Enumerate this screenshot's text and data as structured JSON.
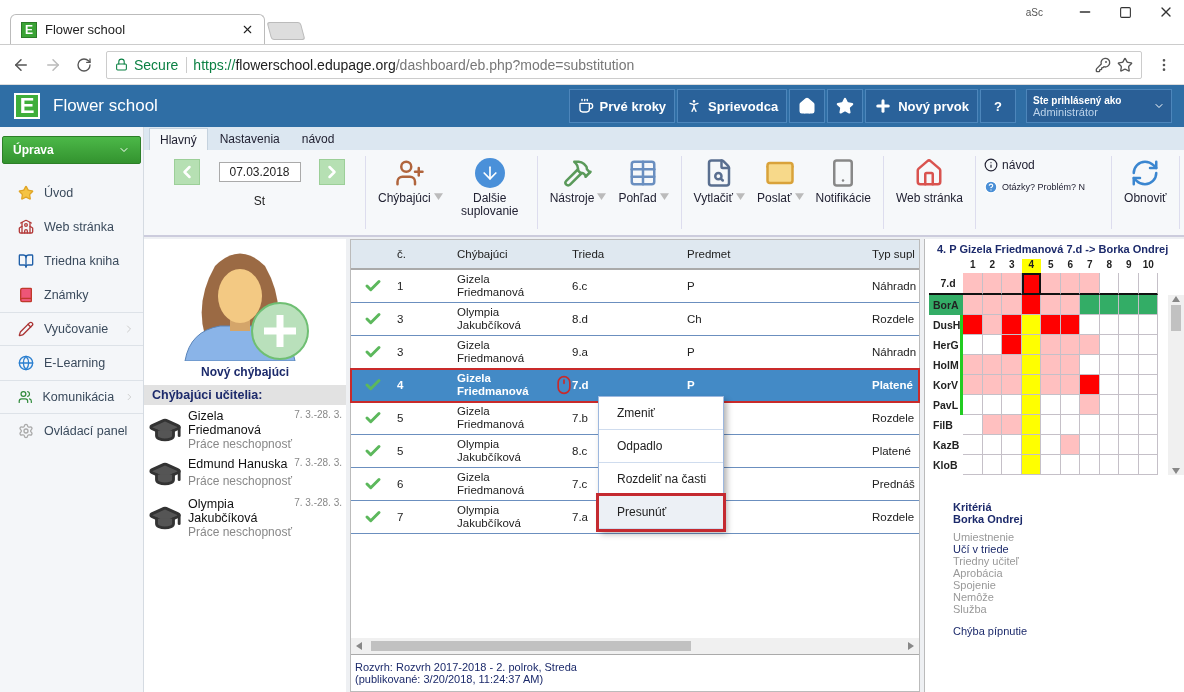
{
  "browser": {
    "tab_title": "Flower school",
    "favicon_letter": "E",
    "profile": "aSc",
    "secure_label": "Secure",
    "url_scheme": "https://",
    "url_host": "flowerschool.edupage.org",
    "url_path": "/dashboard/eb.php?mode=substitution"
  },
  "header": {
    "logo_letter": "E",
    "title": "Flower school",
    "buttons": [
      {
        "kind": "cup",
        "label": "Prvé kroky"
      },
      {
        "kind": "walk",
        "label": "Sprievodca"
      },
      {
        "kind": "home"
      },
      {
        "kind": "star"
      },
      {
        "kind": "plus",
        "label": "Nový prvok"
      },
      {
        "kind": "text",
        "label": "?"
      }
    ],
    "user": {
      "caption": "Ste prihlásený ako",
      "name": "Administrátor"
    }
  },
  "sidebar": {
    "button": "Úprava",
    "items": [
      {
        "kind": "star",
        "label": "Úvod",
        "submenu": false
      },
      {
        "kind": "school",
        "label": "Web stránka",
        "submenu": false
      },
      {
        "kind": "book",
        "label": "Triedna kniha",
        "submenu": false
      },
      {
        "kind": "grades",
        "label": "Známky",
        "submenu": false
      },
      {
        "kind": "teach",
        "label": "Vyučovanie",
        "submenu": true
      },
      {
        "kind": "globe",
        "label": "E-Learning",
        "submenu": false
      },
      {
        "kind": "people",
        "label": "Komunikácia",
        "submenu": true
      },
      {
        "kind": "gear",
        "label": "Ovládací panel",
        "submenu": false
      }
    ]
  },
  "tabs": [
    {
      "label": "Hlavný",
      "selected": true
    },
    {
      "label": "Nastavenia",
      "selected": false
    },
    {
      "label": "návod",
      "selected": false
    }
  ],
  "toolbar": {
    "date": "07.03.2018",
    "weekday": "St",
    "groups": [
      {
        "items": [
          {
            "kind": "person-add",
            "label": "Chýbajúci",
            "dropdown": true
          },
          {
            "kind": "down",
            "label": "Dalšie suplovanie",
            "dropdown": false
          }
        ]
      },
      {
        "items": [
          {
            "kind": "tools",
            "label": "Nástroje",
            "dropdown": true
          },
          {
            "kind": "grid",
            "label": "Pohľad",
            "dropdown": true
          }
        ]
      },
      {
        "items": [
          {
            "kind": "print",
            "label": "Vytlačiť",
            "dropdown": true
          },
          {
            "kind": "mail",
            "label": "Poslať",
            "dropdown": true
          },
          {
            "kind": "phone",
            "label": "Notifikácie",
            "dropdown": false
          }
        ]
      },
      {
        "items": [
          {
            "kind": "house",
            "label": "Web stránka",
            "dropdown": false
          }
        ]
      }
    ],
    "help": {
      "guide": "návod",
      "question": "Otázky? Problém? N"
    },
    "refresh": "Obnoviť"
  },
  "absent": {
    "new_label": "Nový chýbajúci",
    "heading": "Chýbajúci učitelia:",
    "teachers": [
      {
        "name": "Gizela Friedmanová",
        "dates": "7. 3.-28. 3.",
        "reason": "Práce neschopnosť"
      },
      {
        "name": "Edmund Hanuska",
        "dates": "7. 3.-28. 3.",
        "reason": "Práce neschopnosť"
      },
      {
        "name": "Olympia Jakubčíková",
        "dates": "7. 3.-28. 3.",
        "reason": "Práce neschopnosť"
      }
    ]
  },
  "table": {
    "columns": [
      "č.",
      "Chýbajúci",
      "Trieda",
      "Predmet",
      "Typ supl"
    ],
    "rows": [
      {
        "done": true,
        "selected": false,
        "cells": [
          "1",
          "Gizela Friedmanová",
          "6.c",
          "P",
          "Náhradn"
        ]
      },
      {
        "done": true,
        "selected": false,
        "cells": [
          "3",
          "Olympia Jakubčíková",
          "8.d",
          "Ch",
          "Rozdele"
        ]
      },
      {
        "done": true,
        "selected": false,
        "cells": [
          "3",
          "Gizela Friedmanová",
          "9.a",
          "P",
          "Náhradn"
        ]
      },
      {
        "done": true,
        "selected": true,
        "cells": [
          "4",
          "Gizela Friedmanová",
          "7.d",
          "P",
          "Platené"
        ]
      },
      {
        "done": true,
        "selected": false,
        "cells": [
          "5",
          "Gizela Friedmanová",
          "7.b",
          "",
          "Rozdele"
        ]
      },
      {
        "done": true,
        "selected": false,
        "cells": [
          "5",
          "Olympia Jakubčíková",
          "8.c",
          "",
          "Platené"
        ]
      },
      {
        "done": true,
        "selected": false,
        "cells": [
          "6",
          "Gizela Friedmanová",
          "7.c",
          "",
          "Prednáš"
        ]
      },
      {
        "done": true,
        "selected": false,
        "cells": [
          "7",
          "Olympia Jakubčíková",
          "7.a",
          "",
          "Rozdele"
        ]
      }
    ],
    "footer": [
      "Rozvrh: Rozvrh 2017-2018 - 2. polrok, Streda",
      "(publikované: 3/20/2018, 11:24:37 AM)"
    ]
  },
  "context_menu": [
    {
      "label": "Zmeniť",
      "selected": false
    },
    {
      "label": "Odpadlo",
      "selected": false
    },
    {
      "label": "Rozdeliť na časti",
      "selected": false
    },
    {
      "label": "Presunúť",
      "selected": true
    }
  ],
  "grid": {
    "title": "4. P Gizela Friedmanová 7.d -> Borka Ondrej",
    "columns": [
      {
        "label": "1",
        "selected": false
      },
      {
        "label": "2",
        "selected": false
      },
      {
        "label": "3",
        "selected": false
      },
      {
        "label": "4",
        "selected": true
      },
      {
        "label": "5",
        "selected": false
      },
      {
        "label": "6",
        "selected": false
      },
      {
        "label": "7",
        "selected": false
      },
      {
        "label": "8",
        "selected": false
      },
      {
        "label": "9",
        "selected": false
      },
      {
        "label": "10",
        "selected": false
      }
    ],
    "class_row": {
      "label": "7.d",
      "cells": [
        {
          "color": "#ffc0c0",
          "selected": false
        },
        {
          "color": "#ffc0c0",
          "selected": false
        },
        {
          "color": "#ffc0c0",
          "selected": false
        },
        {
          "color": "#ff0000",
          "selected": true
        },
        {
          "color": "#ffc0c0",
          "selected": false
        },
        {
          "color": "#ffc0c0",
          "selected": false
        },
        {
          "color": "#ffc0c0",
          "selected": false
        },
        {
          "color": "#ffffff",
          "selected": false
        },
        {
          "color": "#ffffff",
          "selected": false
        },
        {
          "color": "#ffffff",
          "selected": false
        }
      ]
    },
    "rows": [
      {
        "label": "BorA",
        "selected": true,
        "available": false,
        "cells": [
          {
            "color": "#ffc0c0"
          },
          {
            "color": "#ffc0c0"
          },
          {
            "color": "#ffc0c0"
          },
          {
            "color": "#ff0000"
          },
          {
            "color": "#ffc0c0"
          },
          {
            "color": "#ffc0c0"
          },
          {
            "color": "#33ad66"
          },
          {
            "color": "#33ad66"
          },
          {
            "color": "#33ad66"
          },
          {
            "color": "#33ad66"
          }
        ]
      },
      {
        "label": "DusH",
        "selected": false,
        "available": true,
        "cells": [
          {
            "color": "#ff0000"
          },
          {
            "color": "#ffc0c0"
          },
          {
            "color": "#ff0000"
          },
          {
            "color": "#ffff00"
          },
          {
            "color": "#ff0000"
          },
          {
            "color": "#ff0000"
          },
          {
            "color": "#ffffff"
          },
          {
            "color": "#ffffff"
          },
          {
            "color": "#ffffff"
          },
          {
            "color": "#ffffff"
          }
        ]
      },
      {
        "label": "HerG",
        "selected": false,
        "available": true,
        "cells": [
          {
            "color": "#ffffff"
          },
          {
            "color": "#ffffff"
          },
          {
            "color": "#ff0000"
          },
          {
            "color": "#ffff00"
          },
          {
            "color": "#ffc0c0"
          },
          {
            "color": "#ffc0c0"
          },
          {
            "color": "#ffc0c0"
          },
          {
            "color": "#ffffff"
          },
          {
            "color": "#ffffff"
          },
          {
            "color": "#ffffff"
          }
        ]
      },
      {
        "label": "HolM",
        "selected": false,
        "available": true,
        "cells": [
          {
            "color": "#ffc0c0"
          },
          {
            "color": "#ffc0c0"
          },
          {
            "color": "#ffc0c0"
          },
          {
            "color": "#ffff00"
          },
          {
            "color": "#ffc0c0"
          },
          {
            "color": "#ffc0c0"
          },
          {
            "color": "#ffffff"
          },
          {
            "color": "#ffffff"
          },
          {
            "color": "#ffffff"
          },
          {
            "color": "#ffffff"
          }
        ]
      },
      {
        "label": "KorV",
        "selected": false,
        "available": true,
        "cells": [
          {
            "color": "#ffc0c0"
          },
          {
            "color": "#ffc0c0"
          },
          {
            "color": "#ffc0c0"
          },
          {
            "color": "#ffff00"
          },
          {
            "color": "#ffc0c0"
          },
          {
            "color": "#ffc0c0"
          },
          {
            "color": "#ff0000"
          },
          {
            "color": "#ffffff"
          },
          {
            "color": "#ffffff"
          },
          {
            "color": "#ffffff"
          }
        ]
      },
      {
        "label": "PavL",
        "selected": false,
        "available": true,
        "cells": [
          {
            "color": "#ffffff"
          },
          {
            "color": "#ffffff"
          },
          {
            "color": "#ffffff"
          },
          {
            "color": "#ffff00"
          },
          {
            "color": "#ffffff"
          },
          {
            "color": "#ffffff"
          },
          {
            "color": "#ffc0c0"
          },
          {
            "color": "#ffffff"
          },
          {
            "color": "#ffffff"
          },
          {
            "color": "#ffffff"
          }
        ]
      },
      {
        "label": "FilB",
        "selected": false,
        "available": false,
        "cells": [
          {
            "color": "#ffffff"
          },
          {
            "color": "#ffc0c0"
          },
          {
            "color": "#ffc0c0"
          },
          {
            "color": "#ffff00"
          },
          {
            "color": "#ffffff"
          },
          {
            "color": "#ffffff"
          },
          {
            "color": "#ffffff"
          },
          {
            "color": "#ffffff"
          },
          {
            "color": "#ffffff"
          },
          {
            "color": "#ffffff"
          }
        ]
      },
      {
        "label": "KazB",
        "selected": false,
        "available": false,
        "cells": [
          {
            "color": "#ffffff"
          },
          {
            "color": "#ffffff"
          },
          {
            "color": "#ffffff"
          },
          {
            "color": "#ffff00"
          },
          {
            "color": "#ffffff"
          },
          {
            "color": "#ffc0c0"
          },
          {
            "color": "#ffffff"
          },
          {
            "color": "#ffffff"
          },
          {
            "color": "#ffffff"
          },
          {
            "color": "#ffffff"
          }
        ]
      },
      {
        "label": "KloB",
        "selected": false,
        "available": false,
        "cells": [
          {
            "color": "#ffffff"
          },
          {
            "color": "#ffffff"
          },
          {
            "color": "#ffffff"
          },
          {
            "color": "#ffff00"
          },
          {
            "color": "#ffffff"
          },
          {
            "color": "#ffffff"
          },
          {
            "color": "#ffffff"
          },
          {
            "color": "#ffffff"
          },
          {
            "color": "#ffffff"
          },
          {
            "color": "#ffffff"
          }
        ]
      }
    ]
  },
  "criteria": {
    "title": "Kritériá",
    "teacher": "Borka Ondrej",
    "items": [
      {
        "label": "Umiestnenie",
        "active": false
      },
      {
        "label": "Učí v triede",
        "active": true
      },
      {
        "label": "Triedny učiteľ",
        "active": false
      },
      {
        "label": "Aprobácia",
        "active": false
      },
      {
        "label": "Spojenie",
        "active": false
      },
      {
        "label": "Nemôže",
        "active": false
      },
      {
        "label": "Služba",
        "active": false
      }
    ],
    "footer": "Chýba pípnutie"
  }
}
